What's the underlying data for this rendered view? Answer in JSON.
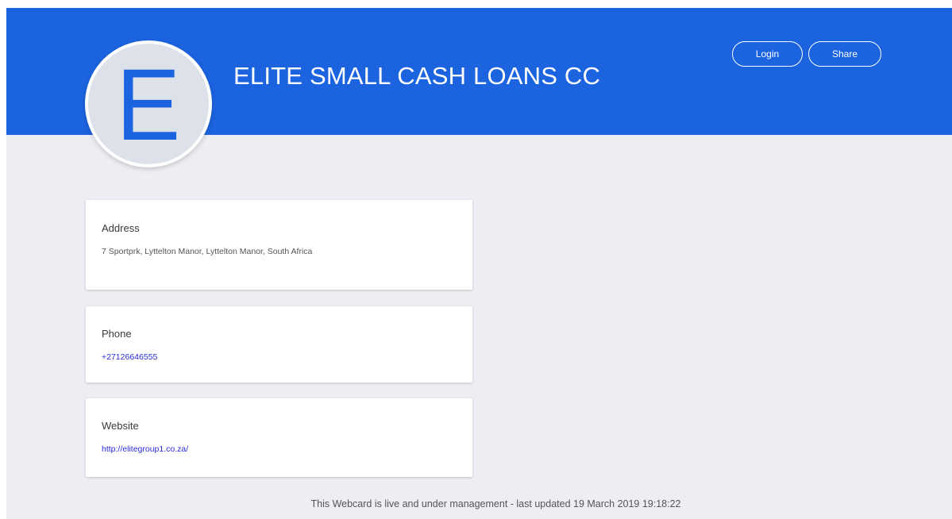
{
  "header": {
    "avatar_letter": "E",
    "company_name": "ELITE SMALL CASH LOANS CC",
    "login_label": "Login",
    "share_label": "Share"
  },
  "cards": {
    "address": {
      "label": "Address",
      "value": "7 Sportprk, Lyttelton Manor, Lyttelton Manor, South Africa"
    },
    "phone": {
      "label": "Phone",
      "value": "+27126646555"
    },
    "website": {
      "label": "Website",
      "value": "http://elitegroup1.co.za/"
    }
  },
  "footer": {
    "status_text": "This Webcard is live and under management - last updated 19 March 2019 19:18:22"
  },
  "colors": {
    "brand_blue": "#1b63df",
    "background": "#eceef3",
    "link": "#2a2ad9"
  }
}
